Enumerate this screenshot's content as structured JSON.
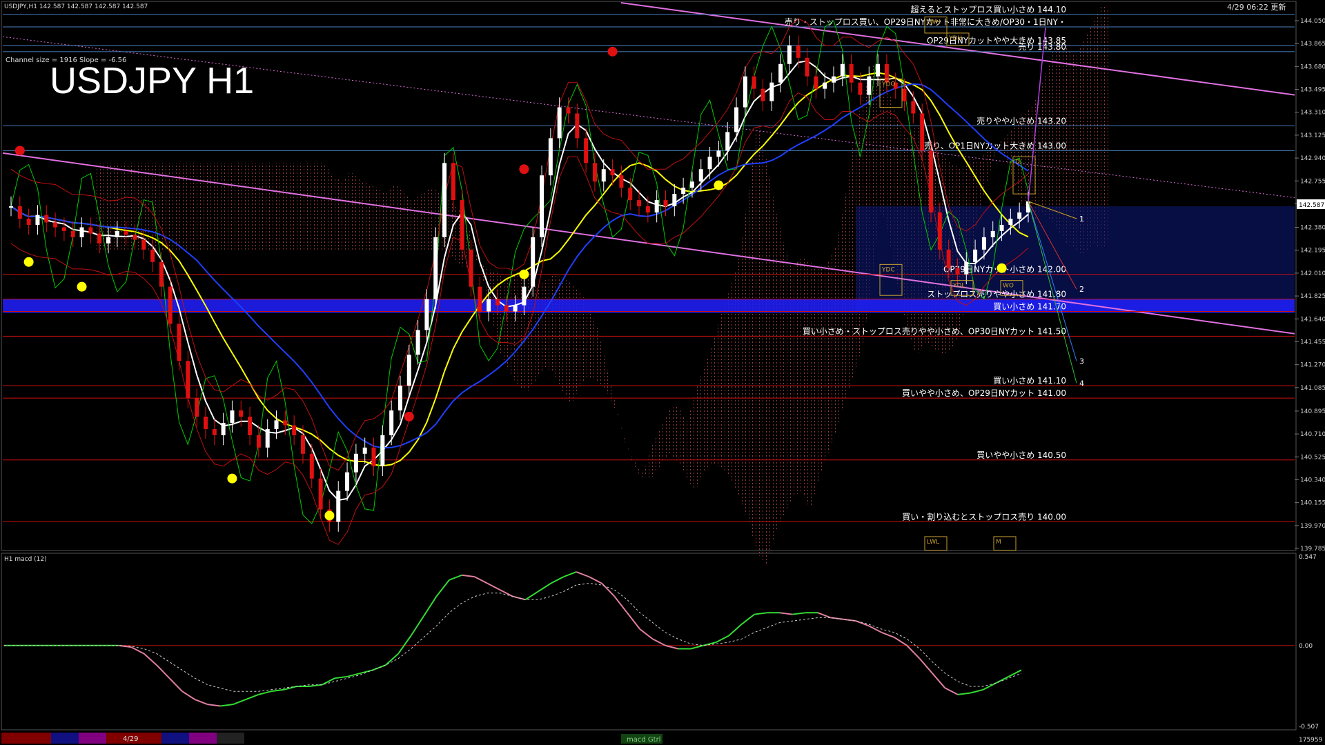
{
  "header": {
    "symbol_info": "USDJPY,H1  142.587 142.587 142.587 142.587",
    "datetime": "4/29 06:22 更新",
    "channel_info": "Channel size = 1916 Slope = -6.56",
    "big_title": "USDJPY H1"
  },
  "chart_data": [
    {
      "type": "line",
      "title": "USDJPY H1",
      "price_axis": {
        "ticks": [
          "144.050",
          "143.865",
          "143.680",
          "143.495",
          "143.310",
          "143.125",
          "142.940",
          "142.755",
          "142.570",
          "142.380",
          "142.195",
          "142.010",
          "141.825",
          "141.640",
          "141.455",
          "141.270",
          "141.085",
          "140.895",
          "140.710",
          "140.525",
          "140.340",
          "140.155",
          "139.970",
          "139.785"
        ],
        "ylim": [
          139.785,
          144.05
        ],
        "current_price": "142.587"
      },
      "levels": [
        {
          "price": 144.1,
          "label": "超えるとストップロス買い小さめ 144.10",
          "color": "#4a7fc0"
        },
        {
          "price": 144.0,
          "label": "売り・ストップロス買い、OP29日NYカット非常に大きめ/OP30・1日NY・",
          "color": "#4a7fc0"
        },
        {
          "price": 143.85,
          "label": "OP29日NYカットやや大きめ 143.85",
          "color": "#4a7fc0"
        },
        {
          "price": 143.8,
          "label": "売り 143.80",
          "color": "#4a7fc0"
        },
        {
          "price": 143.2,
          "label": "売りやや小さめ 143.20",
          "color": "#4a7fc0"
        },
        {
          "price": 143.0,
          "label": "売り、OP1日NYカット大きめ 143.00",
          "color": "#4a7fc0"
        },
        {
          "price": 142.0,
          "label": "OP29日NYカット小さめ 142.00",
          "color": "#d01010"
        },
        {
          "price": 141.8,
          "label": "ストップロス売りやや小さめ 141.80",
          "color": "#d01010"
        },
        {
          "price": 141.7,
          "label": "買い小さめ 141.70",
          "color": "#d01010"
        },
        {
          "price": 141.5,
          "label": "買い小さめ・ストップロス売りやや小さめ、OP30日NYカット 141.50",
          "color": "#d01010"
        },
        {
          "price": 141.1,
          "label": "買い小さめ 141.10",
          "color": "#d01010"
        },
        {
          "price": 141.0,
          "label": "買いやや小さめ、OP29日NYカット 141.00",
          "color": "#d01010"
        },
        {
          "price": 140.5,
          "label": "買いやや小さめ 140.50",
          "color": "#d01010"
        },
        {
          "price": 140.0,
          "label": "買い・割り込むとストップロス売り 140.00",
          "color": "#d01010"
        }
      ],
      "box_labels": [
        "YDO",
        "YDC",
        "YDL",
        "YDH",
        "LWL",
        "LWH",
        "WO",
        "D",
        "M"
      ],
      "projection_labels": [
        "1",
        "2",
        "3",
        "4"
      ],
      "candles_close": [
        142.55,
        142.45,
        142.4,
        142.48,
        142.42,
        142.38,
        142.35,
        142.3,
        142.38,
        142.33,
        142.25,
        142.3,
        142.35,
        142.32,
        142.28,
        142.2,
        142.1,
        141.9,
        141.6,
        141.3,
        141.0,
        140.85,
        140.75,
        140.7,
        140.8,
        140.9,
        140.85,
        140.7,
        140.6,
        140.75,
        140.82,
        140.78,
        140.7,
        140.55,
        140.35,
        140.1,
        140.0,
        140.25,
        140.4,
        140.55,
        140.6,
        140.45,
        140.7,
        140.9,
        141.1,
        141.35,
        141.55,
        141.8,
        142.3,
        142.9,
        142.6,
        142.2,
        141.9,
        141.7,
        141.8,
        141.75,
        141.7,
        141.75,
        141.9,
        142.3,
        142.8,
        143.1,
        143.35,
        143.3,
        143.1,
        142.9,
        142.75,
        142.85,
        142.8,
        142.7,
        142.6,
        142.55,
        142.5,
        142.6,
        142.55,
        142.65,
        142.7,
        142.75,
        142.85,
        142.95,
        143.0,
        143.15,
        143.35,
        143.6,
        143.5,
        143.4,
        143.55,
        143.7,
        143.85,
        143.75,
        143.6,
        143.5,
        143.55,
        143.6,
        143.7,
        143.55,
        143.45,
        143.6,
        143.7,
        143.55,
        143.5,
        143.4,
        143.3,
        143.0,
        142.5,
        142.2,
        142.05,
        142.0,
        142.1,
        142.2,
        142.3,
        142.35,
        142.4,
        142.45,
        142.5,
        142.59
      ],
      "series": [
        {
          "name": "",
          "color": "#ffffff"
        },
        {
          "name": "",
          "color": "#ffff00"
        },
        {
          "name": "",
          "color": "#1f3fff"
        },
        {
          "name": "",
          "color": "#00cc00"
        }
      ]
    },
    {
      "type": "line",
      "title": "H1 macd (12)",
      "ylim": [
        -0.507,
        0.547
      ],
      "zero_label": "0.00",
      "top_label": "0.547",
      "bottom_label": "-0.507",
      "macd": [
        0.0,
        0.0,
        0.0,
        0.0,
        0.0,
        0.0,
        0.0,
        0.0,
        0.0,
        0.0,
        -0.01,
        -0.05,
        -0.12,
        -0.2,
        -0.28,
        -0.33,
        -0.36,
        -0.37,
        -0.36,
        -0.33,
        -0.3,
        -0.28,
        -0.27,
        -0.25,
        -0.25,
        -0.24,
        -0.2,
        -0.19,
        -0.17,
        -0.15,
        -0.12,
        -0.05,
        0.06,
        0.18,
        0.3,
        0.4,
        0.43,
        0.42,
        0.38,
        0.34,
        0.3,
        0.28,
        0.33,
        0.38,
        0.42,
        0.45,
        0.42,
        0.38,
        0.3,
        0.2,
        0.1,
        0.04,
        0.0,
        -0.02,
        -0.02,
        0.0,
        0.02,
        0.06,
        0.13,
        0.19,
        0.2,
        0.2,
        0.19,
        0.2,
        0.2,
        0.17,
        0.16,
        0.15,
        0.12,
        0.08,
        0.05,
        0.0,
        -0.08,
        -0.17,
        -0.26,
        -0.3,
        -0.29,
        -0.27,
        -0.23,
        -0.19,
        -0.15
      ],
      "signal": [
        0.0,
        0.0,
        0.0,
        0.0,
        0.0,
        0.0,
        0.0,
        0.0,
        0.0,
        0.0,
        -0.005,
        -0.02,
        -0.05,
        -0.1,
        -0.15,
        -0.2,
        -0.24,
        -0.26,
        -0.28,
        -0.28,
        -0.28,
        -0.27,
        -0.26,
        -0.25,
        -0.24,
        -0.24,
        -0.22,
        -0.2,
        -0.18,
        -0.15,
        -0.12,
        -0.08,
        -0.02,
        0.05,
        0.12,
        0.2,
        0.26,
        0.3,
        0.32,
        0.32,
        0.3,
        0.28,
        0.28,
        0.3,
        0.33,
        0.37,
        0.38,
        0.37,
        0.34,
        0.28,
        0.2,
        0.14,
        0.08,
        0.04,
        0.01,
        0.0,
        0.01,
        0.02,
        0.04,
        0.08,
        0.11,
        0.14,
        0.15,
        0.16,
        0.17,
        0.17,
        0.16,
        0.15,
        0.13,
        0.1,
        0.08,
        0.04,
        -0.02,
        -0.1,
        -0.17,
        -0.22,
        -0.25,
        -0.25,
        -0.23,
        -0.2,
        -0.17
      ],
      "series": [
        {
          "name": "",
          "color": "#33dd33"
        },
        {
          "name": "",
          "color": "#cccccc"
        }
      ]
    }
  ],
  "bottom_bar": {
    "date_label": "4/29",
    "tab_label": "macd Gtrl",
    "right_label": "175959"
  }
}
